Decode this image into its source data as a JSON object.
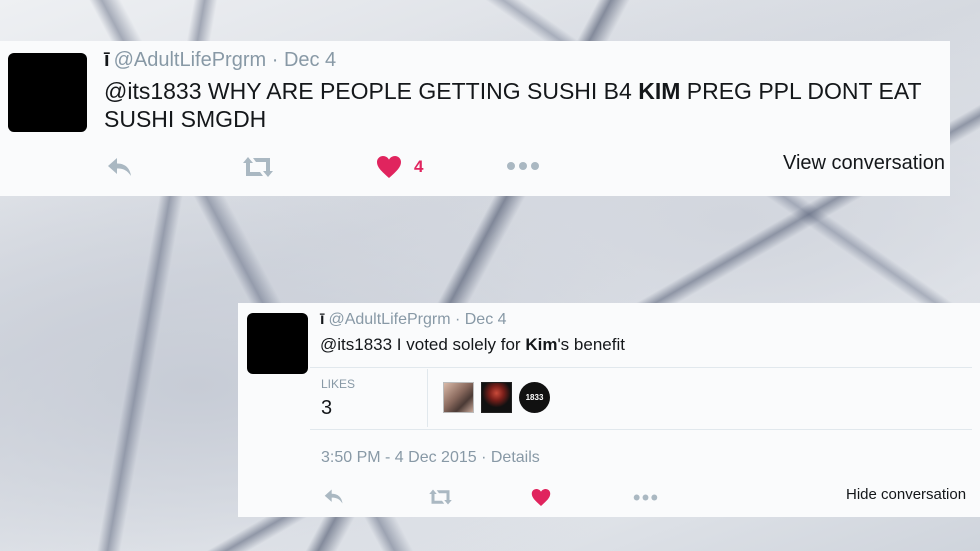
{
  "tweet1": {
    "account_glyph": "ī",
    "handle": "@AdultLifePrgrm",
    "sep": "·",
    "date": "Dec 4",
    "text_part1": "@its1833 WHY ARE PEOPLE GETTING SUSHI B4 ",
    "text_bold": "KIM",
    "text_part2": " PREG PPL DONT EAT SUSHI SMGDH",
    "like_count": "4",
    "view_conversation": "View conversation",
    "icons": [
      "reply-icon",
      "retweet-icon",
      "heart-icon",
      "more-icon"
    ],
    "like_color": "#e0245e"
  },
  "tweet2": {
    "account_glyph": "ī",
    "handle": "@AdultLifePrgrm",
    "sep": "·",
    "date": "Dec 4",
    "text_part1": "@its1833 I voted solely for ",
    "text_bold": "Kim",
    "text_part2": "'s benefit",
    "likes_label": "LIKES",
    "likes_count": "3",
    "liker_badge_text": "1833",
    "timestamp": "3:50 PM - 4 Dec 2015",
    "details_sep": "·",
    "details": "Details",
    "hide_conversation": "Hide conversation",
    "icons": [
      "reply-icon",
      "retweet-icon",
      "heart-icon",
      "more-icon"
    ],
    "like_color": "#e0245e"
  }
}
